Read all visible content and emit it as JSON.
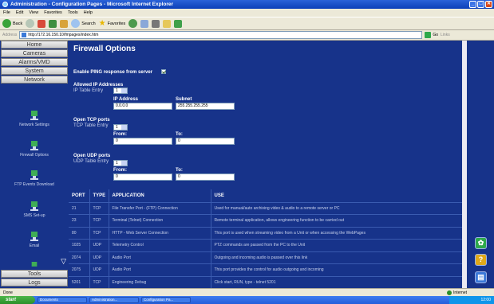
{
  "window": {
    "title": "Administration - Configuration Pages - Microsoft Internet Explorer",
    "controls": [
      "_",
      "□",
      "✕"
    ]
  },
  "menu": [
    "File",
    "Edit",
    "View",
    "Favorites",
    "Tools",
    "Help"
  ],
  "toolbar": {
    "back": "Back",
    "search": "Search",
    "favorites": "Favorites"
  },
  "address": {
    "label": "Address",
    "url": "http://172.16.150.10/fmpages/index.htm",
    "go": "Go",
    "links": "Links"
  },
  "sidebar": {
    "top_buttons": [
      "Home",
      "Cameras",
      "Alarms/VMD",
      "System",
      "Network"
    ],
    "items": [
      "Network Settings",
      "Firewall Options",
      "FTP Events Download",
      "SMS Set-up",
      "Email"
    ],
    "bottom_buttons": [
      "Tools",
      "Logs"
    ],
    "scroll_glyph": "▽"
  },
  "firewall": {
    "title": "Firewall Options",
    "ping_label": "Enable PING response from server",
    "ping_checked": true,
    "allowed": {
      "heading": "Allowed IP Addresses",
      "entry_label": "IP Table Entry",
      "entry_value": "1",
      "ip_label": "IP Address",
      "ip_value": "0.0.0.0",
      "subnet_label": "Subnet",
      "subnet_value": "255.255.255.255"
    },
    "tcp": {
      "heading": "Open TCP ports",
      "entry_label": "TCP Table Entry",
      "entry_value": "1",
      "from_label": "From:",
      "from_value": "0",
      "to_label": "To:",
      "to_value": "0"
    },
    "udp": {
      "heading": "Open UDP ports",
      "entry_label": "UDP Table Entry",
      "entry_value": "1",
      "from_label": "From:",
      "from_value": "0",
      "to_label": "To:",
      "to_value": "0"
    }
  },
  "ports_table": {
    "headers": [
      "PORT",
      "TYPE",
      "APPLICATION",
      "USE"
    ],
    "rows": [
      [
        "21",
        "TCP",
        "File Transfer Port - (FTP) Connection",
        "Used for manual/auto archiving video & audio to a remote server or PC"
      ],
      [
        "23",
        "TCP",
        "Terminal (Telnet) Connection",
        "Remote terminal application, allows engineering function to be carried out"
      ],
      [
        "80",
        "TCP",
        "HTTP - Web Server Connection",
        "This port is used when streaming video from a Unit or when accessing the WebPages"
      ],
      [
        "1025",
        "UDP",
        "Telemetry Control",
        "PTZ commands are passed from the PC to the Unit"
      ],
      [
        "2074",
        "UDP",
        "Audio Port",
        "Outgoing and incoming audio is passed over this link"
      ],
      [
        "2075",
        "UDP",
        "Audio Port",
        "This port provides the control for audio outgoing and incoming"
      ],
      [
        "5201",
        "TCP",
        "Engineering Debug",
        "Click start, RUN, type - telnet 5201"
      ]
    ]
  },
  "right_buttons": [
    "✿",
    "?",
    "▤"
  ],
  "status": {
    "text": "Done",
    "zone": "Internet"
  },
  "taskbar": {
    "start": "start",
    "tasks": [
      "Documents",
      "Administration...",
      "Configuration Pa..."
    ],
    "clock": "12:00"
  },
  "colors": {
    "page_bg": "#17338a",
    "title_blue": "#0c3fb8",
    "button_green": "#2ea94b"
  }
}
